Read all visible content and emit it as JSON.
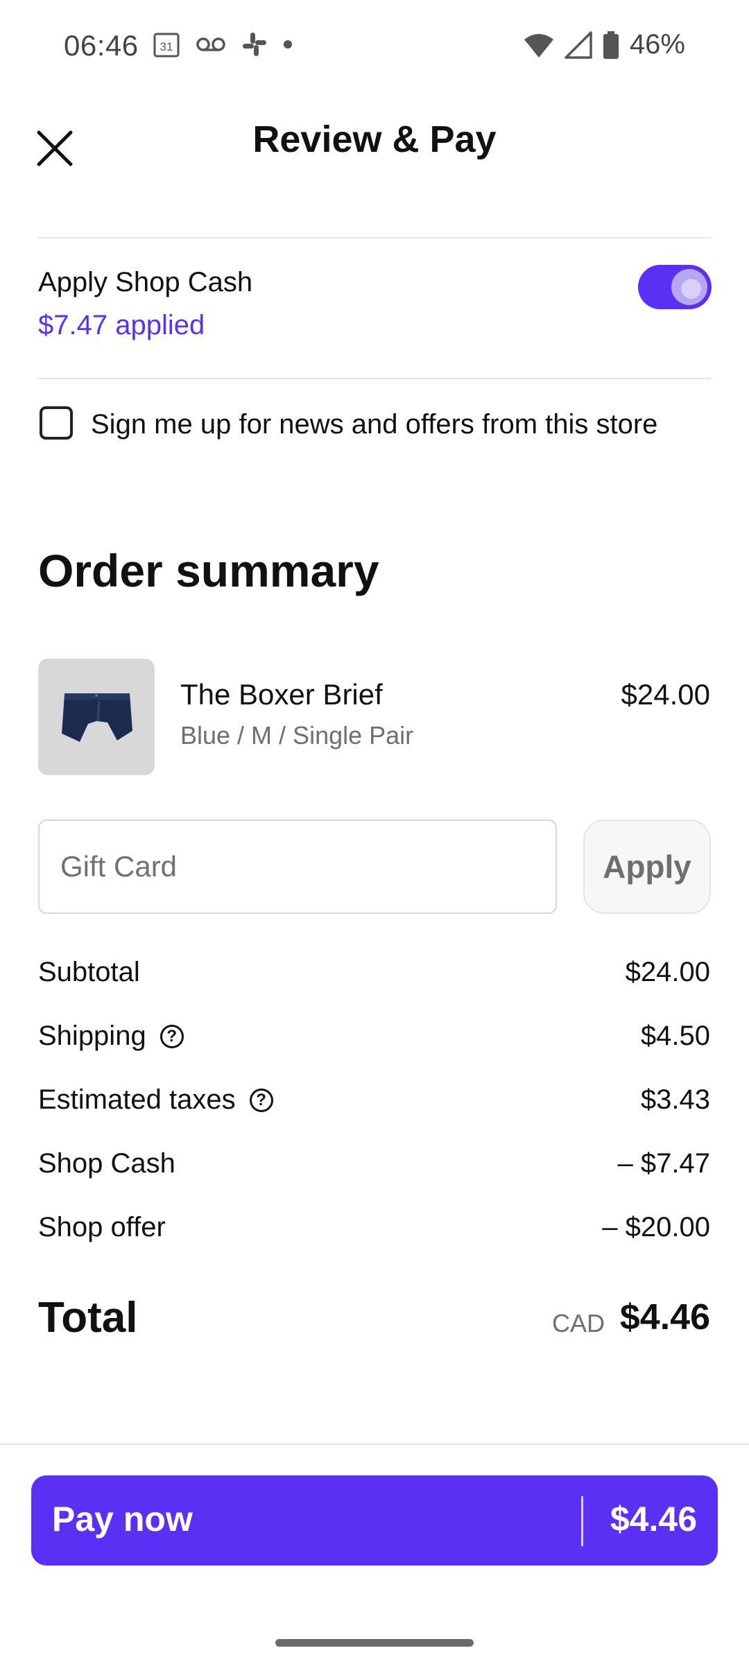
{
  "status_bar": {
    "time": "06:46",
    "calendar_day": "31",
    "battery_percent": "46%",
    "icons": [
      "calendar-icon",
      "voicemail-icon",
      "slack-icon",
      "dot-icon",
      "wifi-icon",
      "signal-icon",
      "battery-icon"
    ]
  },
  "header": {
    "title": "Review & Pay",
    "close_icon": "close-icon"
  },
  "shop_cash": {
    "label": "Apply Shop Cash",
    "applied": "$7.47 applied",
    "toggle_on": true
  },
  "newsletter": {
    "label": "Sign me up for news and offers from this store",
    "checked": false
  },
  "order_summary": {
    "title": "Order summary",
    "item": {
      "name": "The Boxer Brief",
      "variant": "Blue / M / Single Pair",
      "price": "$24.00"
    }
  },
  "gift_card": {
    "placeholder": "Gift Card",
    "value": "",
    "apply_label": "Apply"
  },
  "summary": {
    "subtotal_label": "Subtotal",
    "subtotal_value": "$24.00",
    "shipping_label": "Shipping",
    "shipping_value": "$4.50",
    "taxes_label": "Estimated taxes",
    "taxes_value": "$3.43",
    "shopcash_label": "Shop Cash",
    "shopcash_value": "– $7.47",
    "offer_label": "Shop offer",
    "offer_value": "– $20.00",
    "help_glyph": "?"
  },
  "total": {
    "label": "Total",
    "currency": "CAD",
    "value": "$4.46"
  },
  "pay": {
    "label": "Pay now",
    "amount": "$4.46"
  },
  "colors": {
    "accent": "#5a31f4",
    "text": "#111111",
    "muted": "#6e6e6e",
    "divider": "#e3e3e3"
  }
}
